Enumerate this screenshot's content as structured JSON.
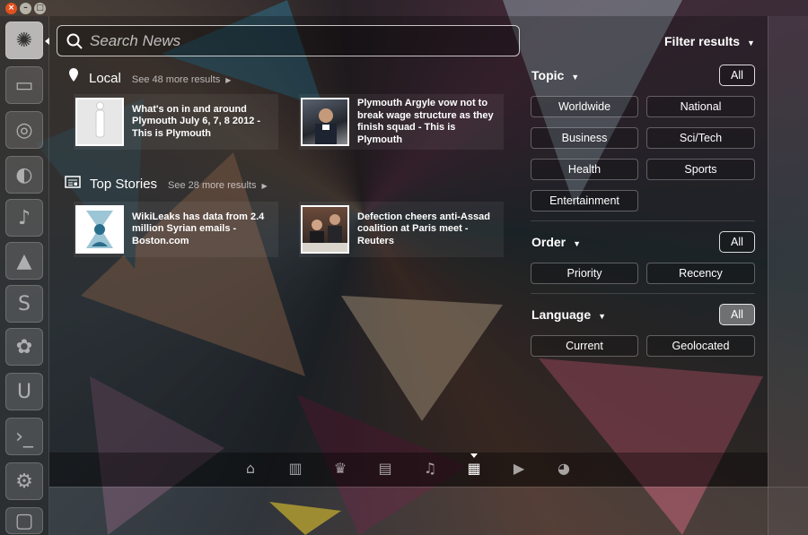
{
  "window_buttons": {
    "close": "×",
    "minimize": "–",
    "maximize": "□"
  },
  "search": {
    "placeholder": "Search News",
    "value": ""
  },
  "filter_header": {
    "label": "Filter results"
  },
  "sections": [
    {
      "title": "Local",
      "more": "See 48 more results",
      "results": [
        {
          "text": "What's on in and around Plymouth July 6, 7, 8 2012 - This is Plymouth",
          "thumb_icon": "info-icon"
        },
        {
          "text": "Plymouth Argyle vow not to break wage structure as they finish squad - This is Plymouth",
          "thumb_icon": "photo"
        }
      ]
    },
    {
      "title": "Top Stories",
      "more": "See 28 more results",
      "results": [
        {
          "text": "WikiLeaks has data from 2.4 million Syrian emails - Boston.com",
          "thumb_icon": "wikileaks-logo"
        },
        {
          "text": "Defection cheers anti-Assad coalition at Paris meet - Reuters",
          "thumb_icon": "photo"
        }
      ]
    }
  ],
  "filters": {
    "topic": {
      "title": "Topic",
      "all": "All",
      "options": [
        "Worldwide",
        "National",
        "Business",
        "Sci/Tech",
        "Health",
        "Sports",
        "Entertainment"
      ]
    },
    "order": {
      "title": "Order",
      "all": "All",
      "options": [
        "Priority",
        "Recency"
      ]
    },
    "language": {
      "title": "Language",
      "all": "All",
      "options": [
        "Current",
        "Geolocated"
      ]
    }
  },
  "lenses": [
    "home-icon",
    "applications-icon",
    "social-icon",
    "files-icon",
    "music-icon",
    "news-icon",
    "video-icon",
    "photo-icon"
  ],
  "launcher_icons": [
    "ubuntu-logo",
    "folder-icon",
    "chrome-icon",
    "firefox-icon",
    "music-icon",
    "drive-icon",
    "s-icon",
    "photo-icon",
    "u-icon",
    "terminal-icon",
    "settings-icon",
    "workspace-icon"
  ],
  "colors": {
    "accent": "#ffffff",
    "close": "#e0511f",
    "minimize": "#b8b3a8",
    "maximize": "#b8b3a8"
  }
}
